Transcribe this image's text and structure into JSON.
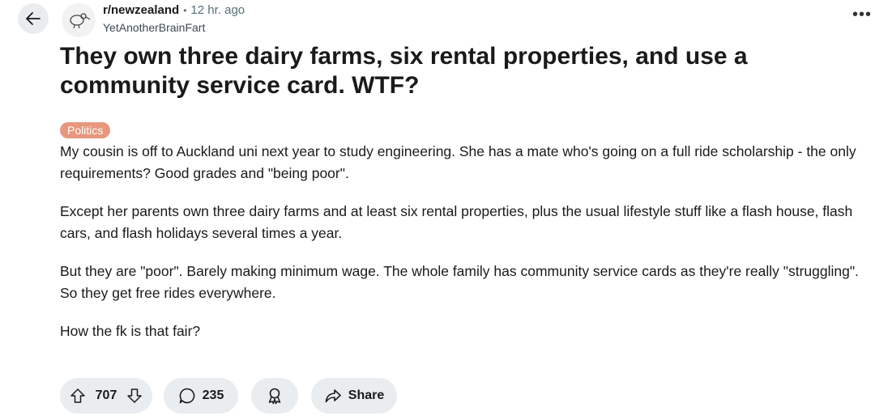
{
  "post": {
    "subreddit": "r/newzealand",
    "separator": "•",
    "time_ago": "12 hr. ago",
    "author": "YetAnotherBrainFart",
    "title": "They own three dairy farms, six rental properties, and use a community service card. WTF?",
    "flair": "Politics",
    "flair_color": "#e8977e",
    "paragraphs": [
      "My cousin is off to Auckland uni next year to study engineering. She has a mate who's going on a full ride scholarship - the only requirements? Good grades and \"being poor\".",
      "Except her parents own three dairy farms and at least six rental properties, plus the usual lifestyle stuff like a flash house, flash cars, and flash holidays several times a year.",
      "But they are \"poor\". Barely making minimum wage. The whole family has community service cards as they're really \"struggling\". So they get free rides everywhere.",
      "How the fk is that fair?"
    ]
  },
  "actions": {
    "upvotes": "707",
    "comments": "235",
    "share_label": "Share"
  },
  "icons": {
    "back": "arrow-left-icon",
    "avatar": "kiwi-bird-icon",
    "more": "more-options-icon",
    "upvote": "upvote-arrow-icon",
    "downvote": "downvote-arrow-icon",
    "comment": "comment-bubble-icon",
    "award": "award-icon",
    "share": "share-arrow-icon"
  }
}
